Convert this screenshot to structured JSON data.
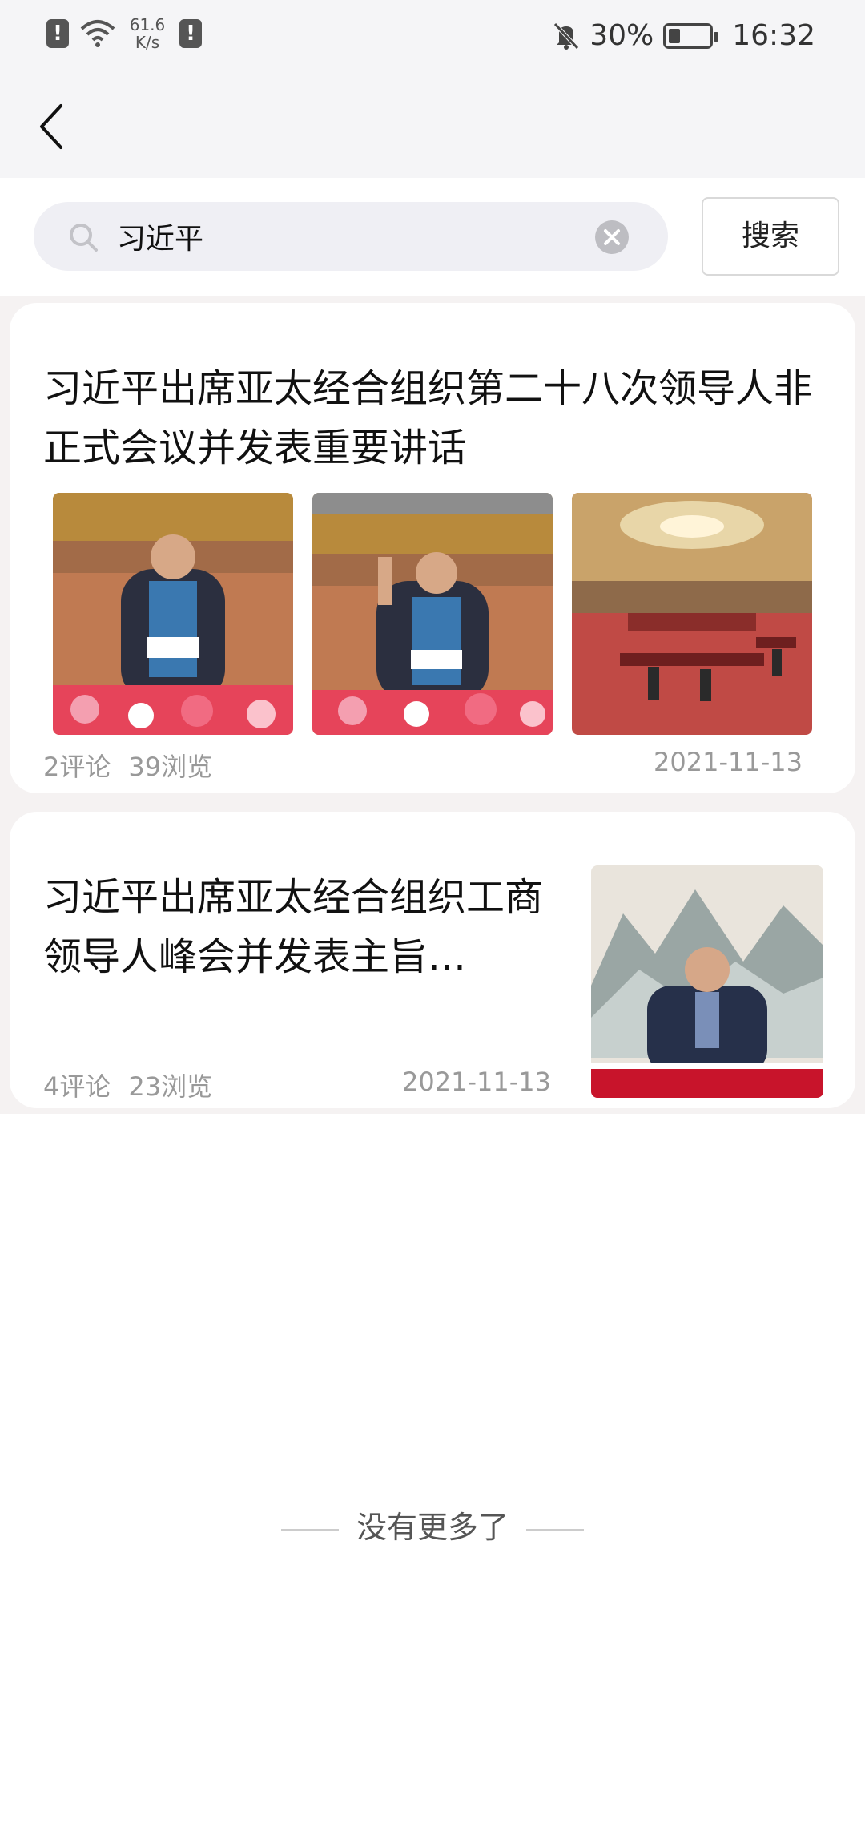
{
  "status_bar": {
    "network_speed_value": "61.6",
    "network_speed_unit": "K/s",
    "battery_percent": "30%",
    "battery_level": 0.3,
    "time": "16:32",
    "icons": [
      "alert-icon",
      "wifi-icon",
      "alert-icon",
      "mute-bell-icon",
      "battery-icon"
    ]
  },
  "nav": {
    "back_icon": "back-chevron-icon"
  },
  "search": {
    "value": "习近平",
    "placeholder": "",
    "button_label": "搜索"
  },
  "results": [
    {
      "title": "习近平出席亚太经合组织第二十八次领导人非正式会议并发表重要讲话",
      "comments": "2评论",
      "views": "39浏览",
      "date": "2021-11-13",
      "images": [
        "photo-leader-speaking",
        "photo-leader-waving",
        "photo-meeting-hall"
      ]
    },
    {
      "title": "习近平出席亚太经合组织工商领导人峰会并发表主旨…",
      "comments": "4评论",
      "views": "23浏览",
      "date": "2021-11-13",
      "images": [
        "photo-leader-landscape-backdrop"
      ]
    }
  ],
  "footer": {
    "no_more": "没有更多了"
  }
}
